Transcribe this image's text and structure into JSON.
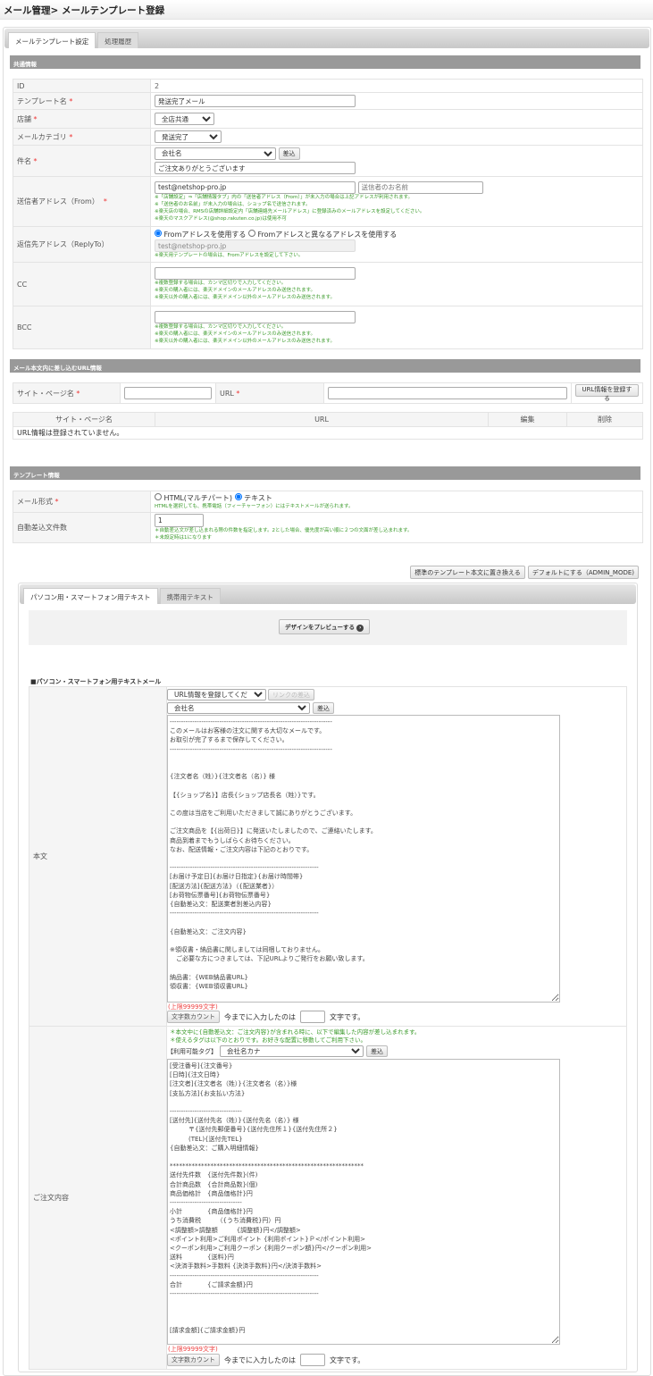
{
  "header": {
    "title": "メール管理> メールテンプレート登録"
  },
  "tabs": [
    {
      "label": "メールテンプレート設定"
    },
    {
      "label": "処理履歴"
    }
  ],
  "common": {
    "title": "共通情報",
    "id_label": "ID",
    "id_value": "2",
    "name_label": "テンプレート名",
    "name_value": "発送完了メール",
    "shop_label": "店舗",
    "shop_value": "全店共通",
    "category_label": "メールカテゴリ",
    "category_value": "発送完了",
    "subject_label": "件名",
    "subject_tag": "会社名",
    "insert": "差込",
    "subject_value": "ご注文ありがとうございます",
    "from_label": "送信者アドレス（From）",
    "from_value": "test@netshop-pro.jp",
    "from_name_placeholder": "送信者のお名前",
    "from_notes": [
      "※「店舗設定」⇒「店舗情報タブ」内の「送信者アドレス（From）」が未入力の場合は上記アドレスが利用されます。",
      "※「送信者のお名前」が未入力の場合は、ショップ名で送信されます。",
      "※楽天店の場合、RMSの店舗詳細設定内「店舗連絡先メールアドレス」に登録済みのメールアドレスを設定してください。",
      "※楽天のマスクアドレス(@shop.rakuten.co.jp)は使用不可"
    ],
    "reply_label": "返信先アドレス（ReplyTo）",
    "reply_opt1": "Fromアドレスを使用する",
    "reply_opt2": "Fromアドレスと異なるアドレスを使用する",
    "reply_value": "test@netshop-pro.jp",
    "reply_note": "※楽天用テンプレートの場合は、Fromアドレスを設定して下さい。",
    "cc_label": "CC",
    "bcc_label": "BCC",
    "cc_notes": [
      "※複数登録する場合は、カンマ区切りで入力してください。",
      "※楽天の購入者には、楽天ドメインのメールアドレスのみ送信されます。",
      "※楽天以外の購入者には、楽天ドメイン以外のメールアドレスのみ送信されます。"
    ]
  },
  "url": {
    "title": "メール本文内に差し込むURL情報",
    "site_label": "サイト・ページ名",
    "url_label": "URL",
    "register": "URL情報を登録する",
    "columns": [
      "サイト・ページ名",
      "URL",
      "編集",
      "削除"
    ],
    "empty": "URL情報は登録されていません。"
  },
  "template": {
    "title": "テンプレート情報",
    "format_label": "メール形式",
    "format_html": "HTML(マルチパート)",
    "format_text": "テキスト",
    "format_note": "HTMLを選択しても、携帯電話（フィーチャーフォン）にはテキストメールが送られます。",
    "auto_label": "自動差込文件数",
    "auto_value": "1",
    "auto_notes": [
      "＊自動差込文が差し込まれる際の件数を指定します。2とした場合、優先度が高い順に２つの文面が差し込まれます。",
      "＊未設定時は1になります"
    ]
  },
  "actions": {
    "replace": "標準のテンプレート本文に置き換える",
    "default": "デフォルトにする（ADMIN_MODE)"
  },
  "inner_tabs": [
    {
      "label": "パソコン用・スマートフォン用テキスト"
    },
    {
      "label": "携帯用テキスト"
    }
  ],
  "preview": "デザインをプレビューする",
  "mail": {
    "heading": "■パソコン・スマートフォン用テキストメール",
    "body_label": "本文",
    "url_select": "URL情報を登録してください",
    "link_insert": "リンクの差込",
    "tag_select": "会社名",
    "insert": "差込",
    "body": "------------------------------------------------------------------------\nこのメールはお客様の注文に関する大切なメールです。\nお取引が完了するまで保存してください。\n------------------------------------------------------------------------\n\n\n{注文者名（姓）}{注文者名（名）} 様\n\n【{ショップ名}】店長{ショップ店長名（姓）}です。\n\nこの度は当店をご利用いただきまして誠にありがとうございます。\n\nご注文商品を【{出荷日}】に発送いたしましたので、ご連絡いたします。\n商品到着までもうしばらくお待ちください。\nなお、配送情報・ご注文内容は下記のとおりです。\n\n------------------------------------------------------------------\n[お届け予定日]{お届け日指定}{お届け時間帯}\n[配送方法]{配送方法}（{配送業者}）\n[お荷物伝票番号]{お荷物伝票番号}\n{自動差込文：配送業者別差込内容}\n------------------------------------------------------------------\n\n{自動差込文：ご注文内容}\n\n※領収書・納品書に関しましては同梱しておりません。\n　ご必要な方につきましては、下記URLよりご発行をお願い致します。\n\n納品書：{WEB納品書URL}\n領収書：{WEB領収書URL}",
    "limit": "(上限99999文字)",
    "count_btn": "文字数カウント",
    "count_pre": "今までに入力したのは",
    "count_post": "文字です。",
    "order_label": "ご注文内容",
    "order_notes": [
      "＊本文中に{自動差込文：ご注文内容}が含まれる時に、以下で編集した内容が差し込まれます。",
      "＊使えるタグは以下のとおりです。お好きな配置に移動してご利用下さい。"
    ],
    "order_tag_label": "【利用可能タグ】",
    "order_tag": "会社名カナ",
    "order_body": "[受注番号]{注文番号}\n[日時]{注文日時}\n[注文者]{注文者名（姓）}{注文者名（名）}様\n[支払方法]{お支払い方法}\n\n--------------------------------\n[送付先]{送付先名（姓）}{送付先名（名）} 様\n　　　〒{送付先郵便番号}{送付先住所１}{送付先住所２}\n　　　(TEL){送付先TEL}\n{自動差込文：ご購入明細情報}\n\n**************************************************************\n送付先件数　{送付先件数}(件)\n合計商品数　{合計商品数}(個)\n商品価格計　{商品価格計}円\n--------------------------------\n小計　　　　{商品価格計}円\nうち消費税　　　（{うち消費税}円）円\n<調整額>調整額　　　{調整額}円</調整額>\n<ポイント利用>ご利用ポイント {利用ポイント}Ｐ</ポイント利用>\n<クーポン利用>ご利用クーポン {利用クーポン額}円</クーポン利用>\n送料　　　　{送料}円\n<決済手数料>手数料 {決済手数料}円</決済手数料>\n------------------------------------------------------------------\n合計　　　　{ご請求金額}円\n------------------------------------------------------------------\n\n\n\n[請求金額]{ご請求金額}円"
  }
}
